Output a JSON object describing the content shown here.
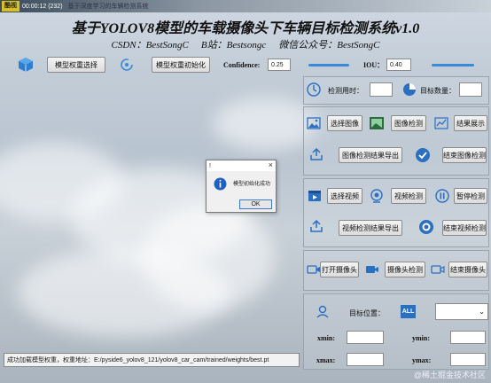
{
  "window": {
    "badge": "酷视",
    "time": "00:00:12 (232)",
    "name": "基于深度学习的车辆检测系统"
  },
  "header": {
    "title": "基于YOLOV8模型的车载摄像头下车辆目标检测系统v1.0",
    "csdn": "CSDN：BestSongC",
    "bilibili": "B站：Bestsongc",
    "wechat": "微信公众号：BestSongC"
  },
  "toolbar": {
    "select_weights": "模型权重选择",
    "init_weights": "模型权重初始化",
    "confidence_label": "Confidence:",
    "confidence_value": "0.25",
    "iou_label": "IOU：",
    "iou_value": "0.40"
  },
  "stats": {
    "time_label": "检测用时：",
    "time_value": "",
    "count_label": "目标数量：",
    "count_value": ""
  },
  "image_section": {
    "select_image": "选择图像",
    "detect_image": "图像检测",
    "show_result": "结果展示",
    "export_result": "图像检测结果导出",
    "end_detect": "结束图像检测"
  },
  "video_section": {
    "select_video": "选择视频",
    "detect_video": "视频检测",
    "pause": "暂停检测",
    "export_result": "视频检测结果导出",
    "end_detect": "结束视频检测"
  },
  "camera_section": {
    "open_camera": "打开摄像头",
    "detect_camera": "摄像头检测",
    "close_camera": "结束摄像头"
  },
  "target": {
    "label": "目标位置：",
    "all": "ALL",
    "selected": "",
    "xmin": "xmin:",
    "ymin": "ymin:",
    "xmax": "xmax:",
    "ymax": "ymax:"
  },
  "status": {
    "message": "成功加载模型权重，权重地址：E:/pyside6_yolov8_121/yolov8_car_cam/trained/weights/best.pt"
  },
  "dialog": {
    "title": "!",
    "close": "×",
    "message": "模型初始化成功",
    "ok": "OK"
  },
  "watermark": "@稀土掘金技术社区",
  "colors": {
    "accent": "#3b8ad8",
    "info": "#1f5fbf"
  }
}
